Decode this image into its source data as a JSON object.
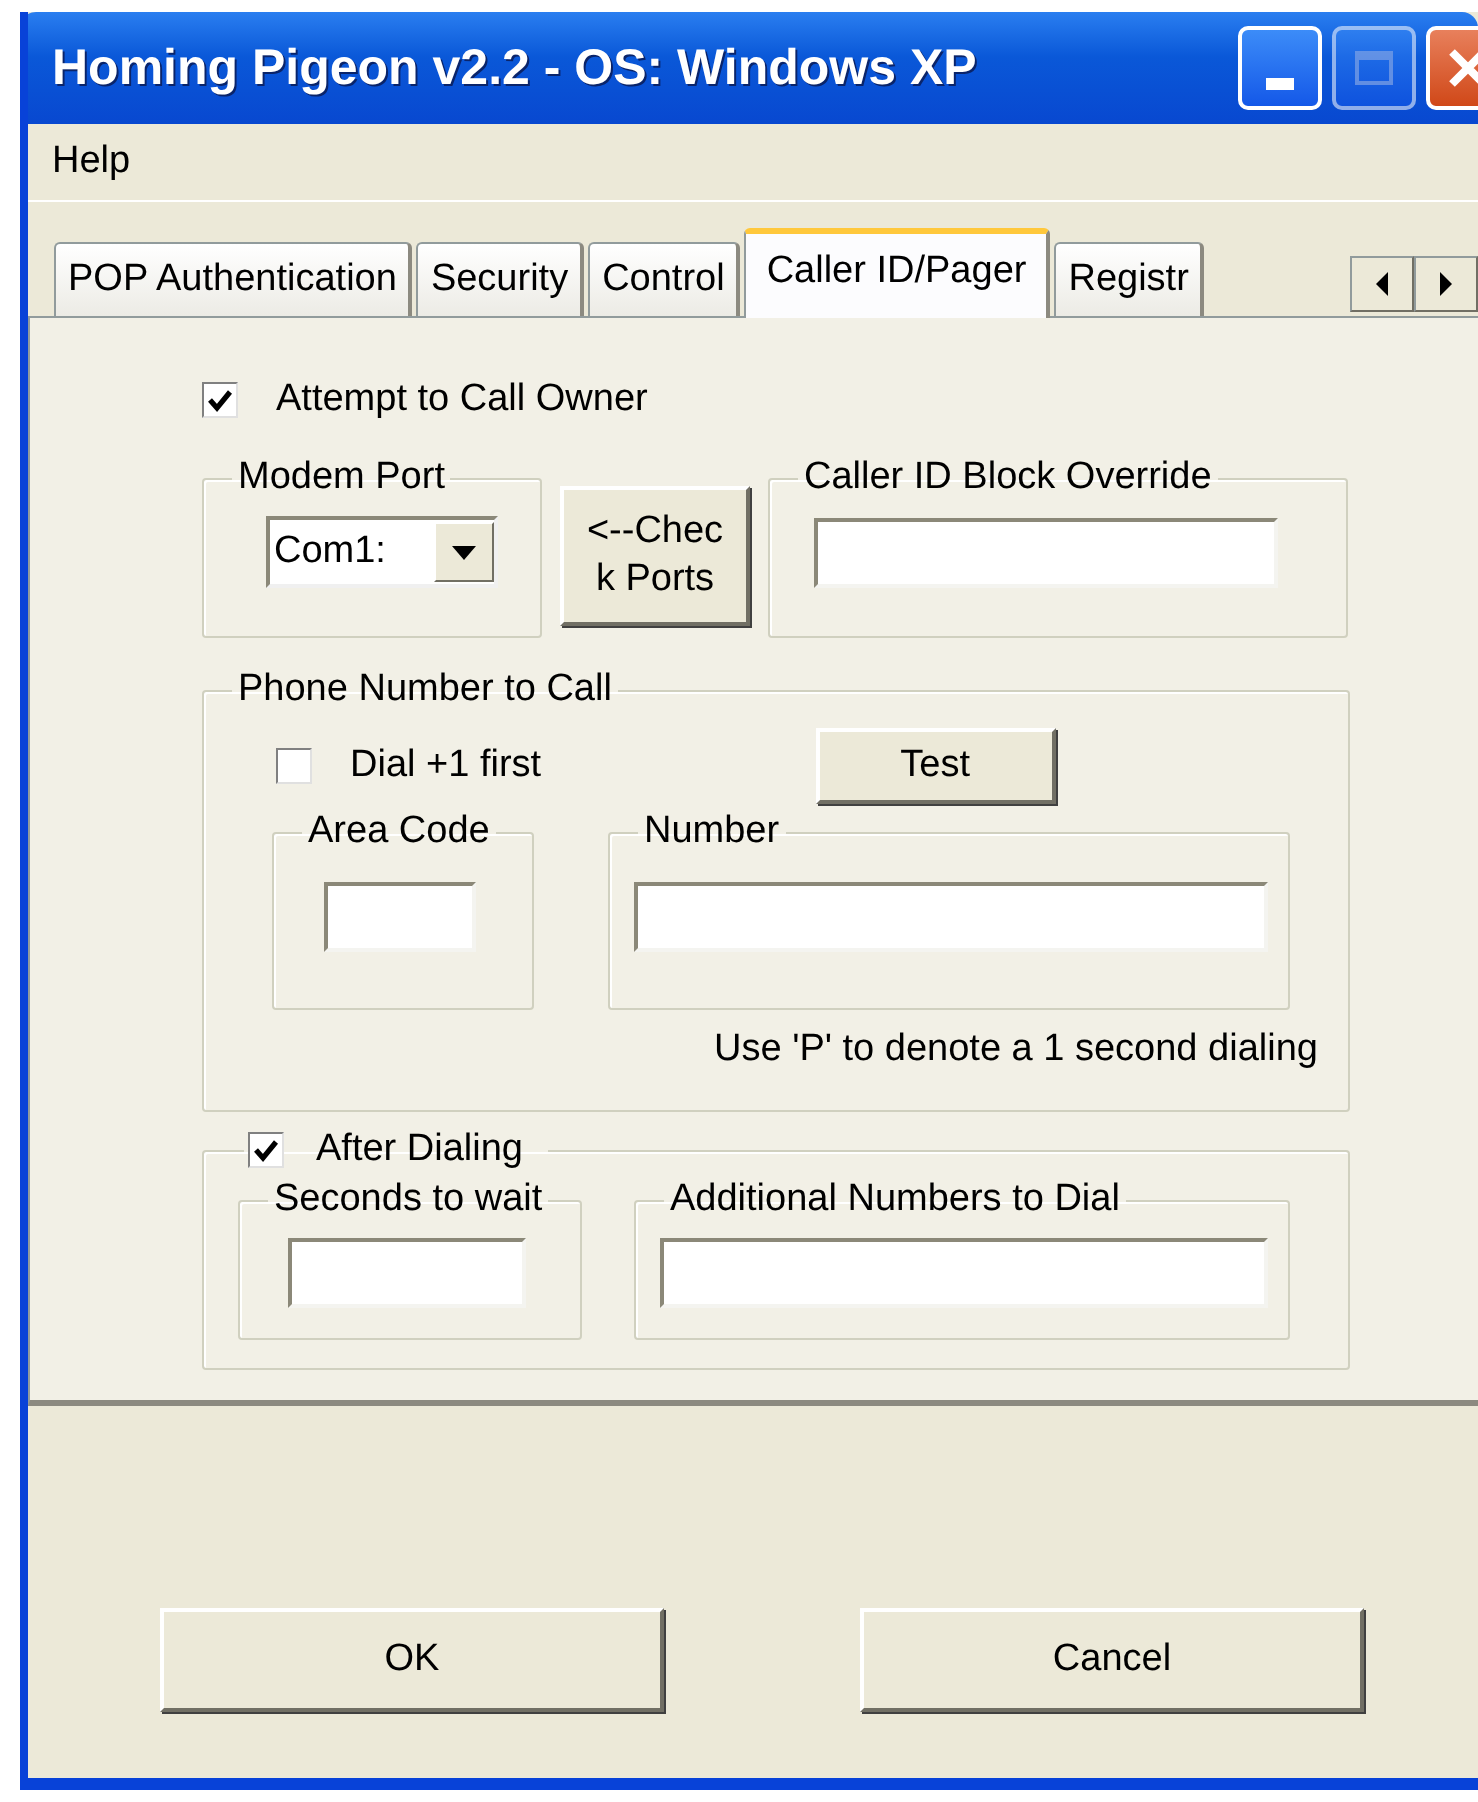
{
  "window": {
    "title": "Homing Pigeon v2.2 - OS: Windows XP",
    "controls": [
      {
        "kind": "minimize",
        "disabled": false
      },
      {
        "kind": "maximize",
        "disabled": true
      },
      {
        "kind": "close",
        "disabled": false
      }
    ]
  },
  "menu": [
    "Help"
  ],
  "tabs": [
    {
      "label": "POP Authentication",
      "selected": false
    },
    {
      "label": "Security",
      "selected": false
    },
    {
      "label": "Control",
      "selected": false
    },
    {
      "label": "Caller ID/Pager",
      "selected": true
    },
    {
      "label": "Registr",
      "selected": false
    }
  ],
  "attempt_call": {
    "label": "Attempt to Call Owner",
    "checked": true
  },
  "modem_port": {
    "label": "Modem Port",
    "value": "Com1:"
  },
  "check_ports_button": [
    "<--Chec",
    "k Ports"
  ],
  "caller_id_block": {
    "label": "Caller ID Block Override"
  },
  "phone": {
    "label": "Phone Number to Call",
    "dial_plus_one": {
      "label": "Dial +1 first",
      "checked": false
    },
    "test_button": "Test",
    "area_code": {
      "label": "Area Code"
    },
    "number": {
      "label": "Number"
    },
    "hint": "Use 'P' to denote a 1 second dialing"
  },
  "after_dialing": {
    "label": "After Dialing",
    "checked": true,
    "seconds": {
      "label": "Seconds to wait"
    },
    "additional": {
      "label": "Additional Numbers to Dial"
    }
  },
  "buttons": [
    "OK",
    "Cancel"
  ]
}
